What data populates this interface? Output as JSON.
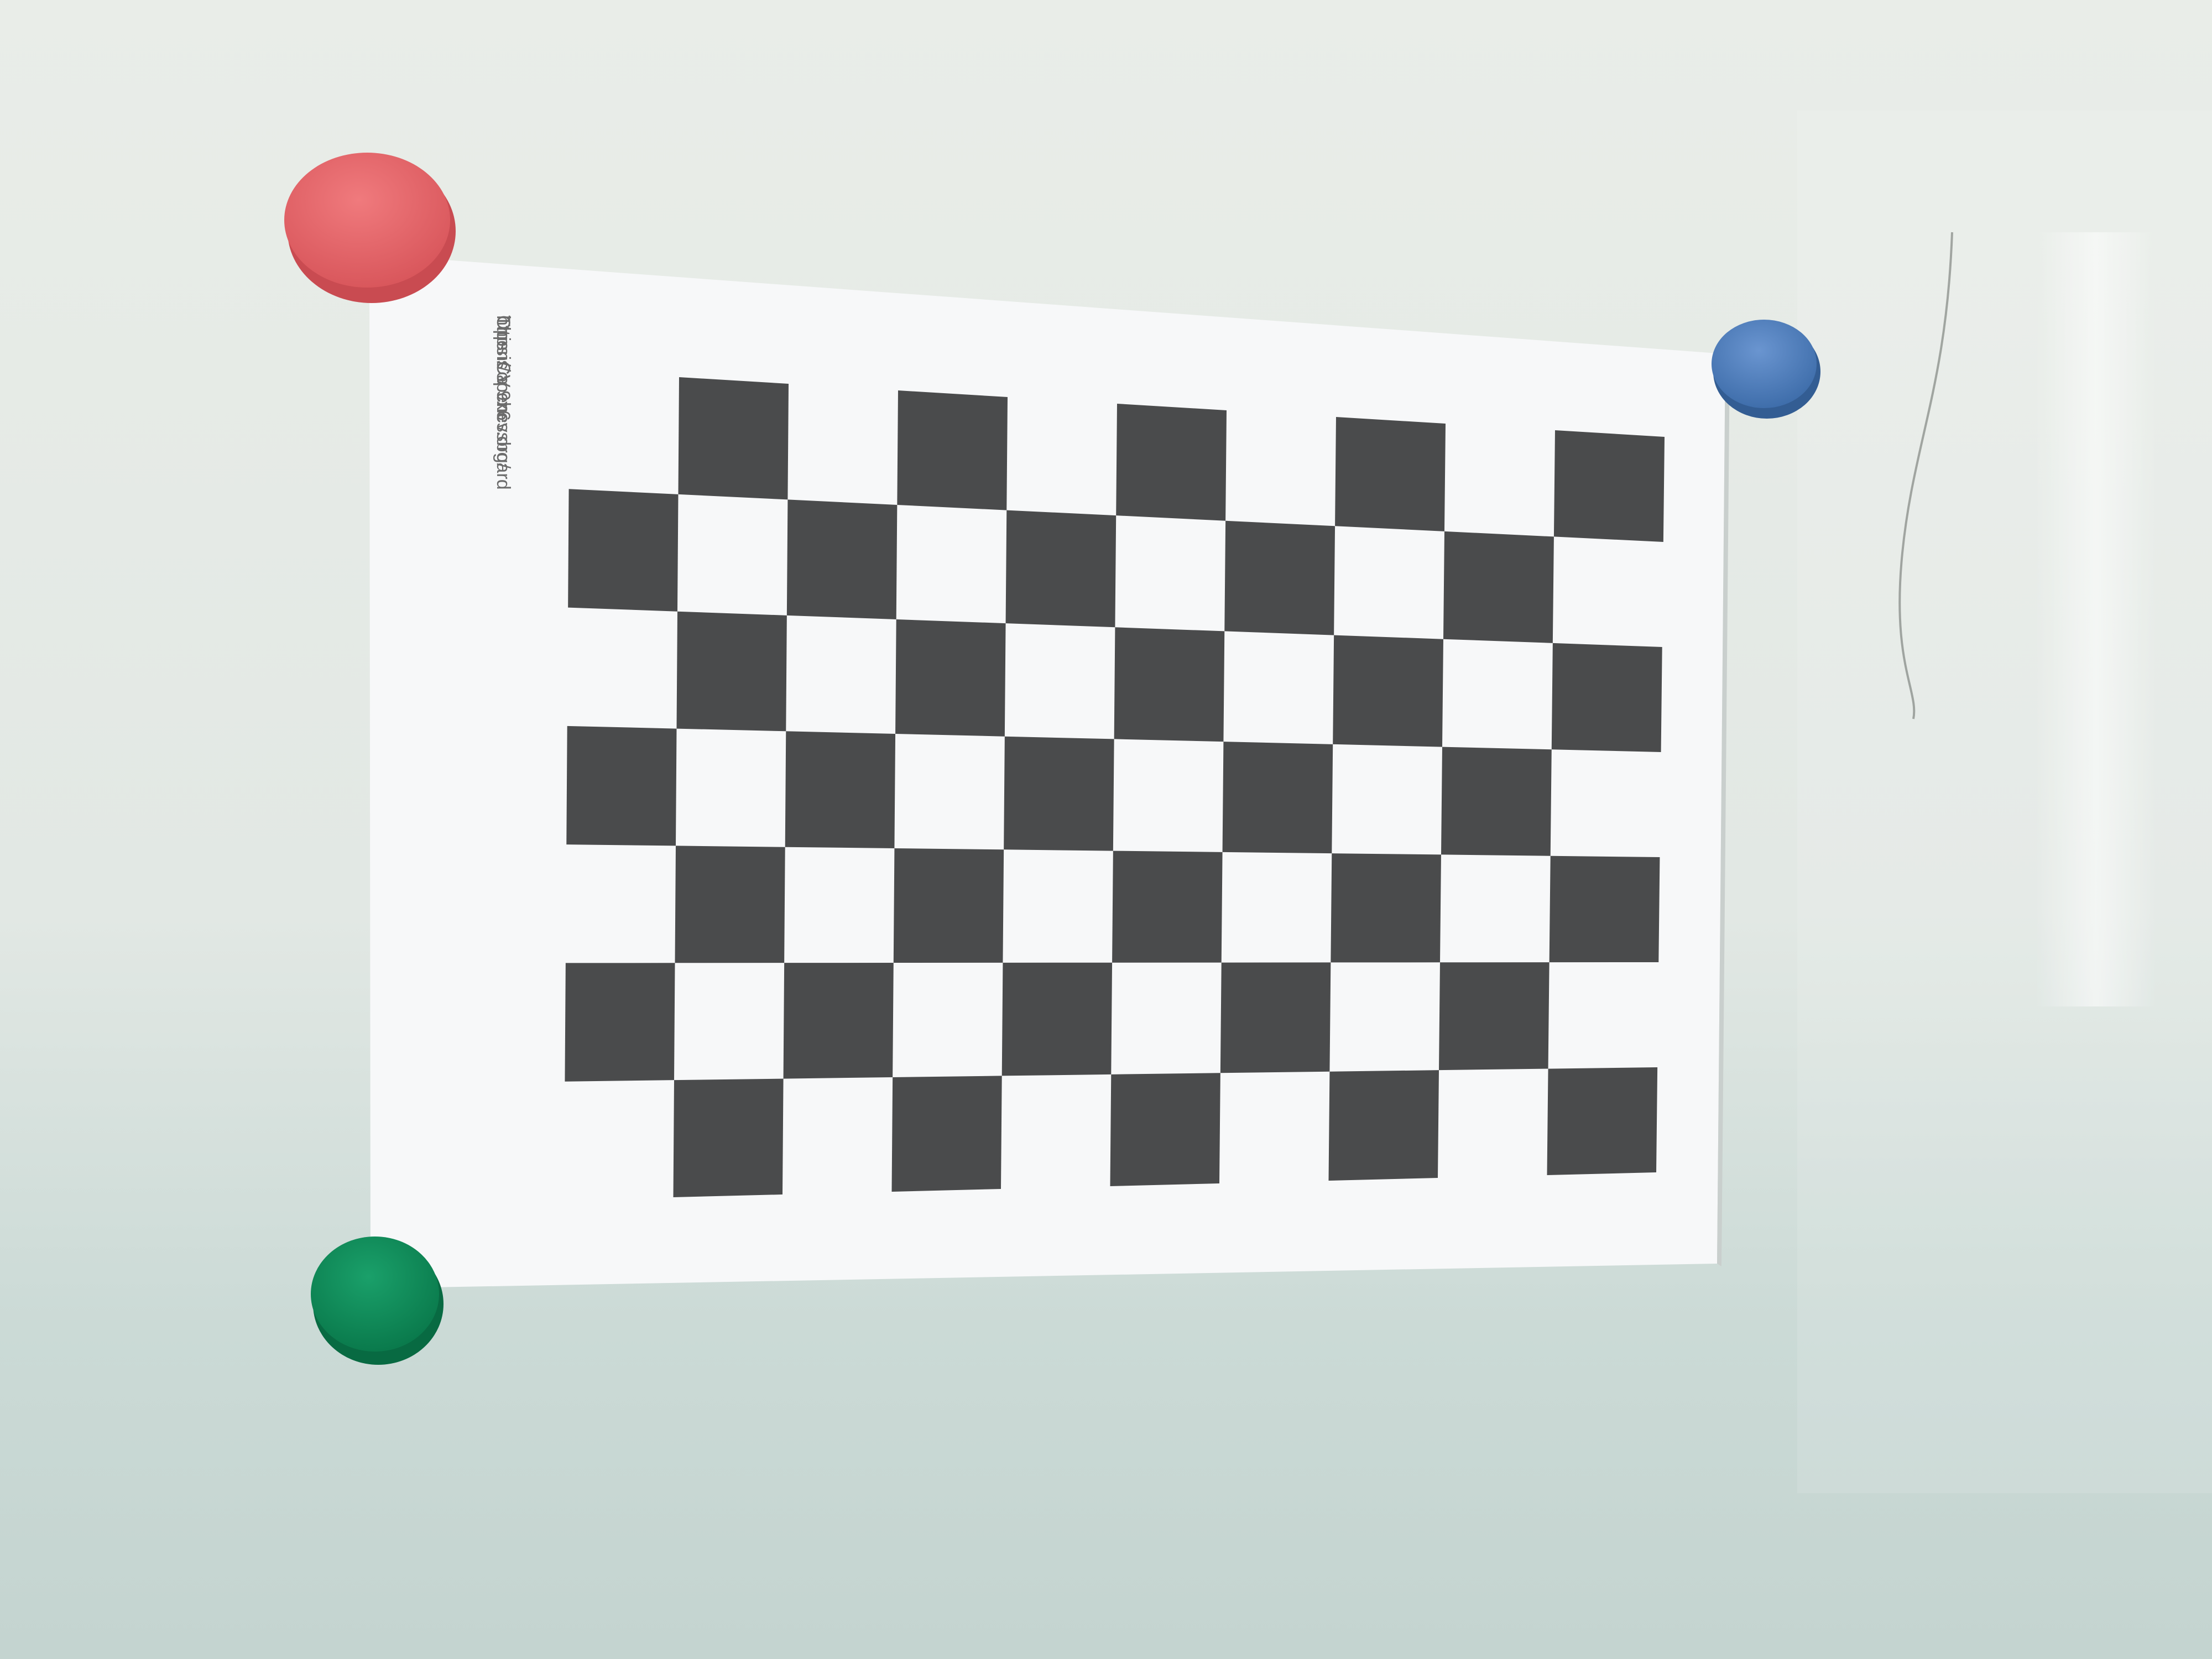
{
  "scene": {
    "caption_lines": [
      "This is a 9x6",
      "OpenCV chessboard",
      "https://opencv.org/"
    ],
    "pattern": {
      "columns": 9,
      "rows": 6
    },
    "colors": {
      "wall_top": "#e8ece6",
      "wall_bottom": "#c9d8d4",
      "paper": "#f7f8f9",
      "square": "#4a4b4c",
      "magnet_red": "#e8666a",
      "magnet_blue": "#4f7fc0",
      "magnet_green": "#0e8f5a"
    },
    "magnets": [
      {
        "name": "magnet-red",
        "color": "#e8666a"
      },
      {
        "name": "magnet-blue",
        "color": "#4f7fc0"
      },
      {
        "name": "magnet-green",
        "color": "#0e8f5a"
      }
    ]
  }
}
